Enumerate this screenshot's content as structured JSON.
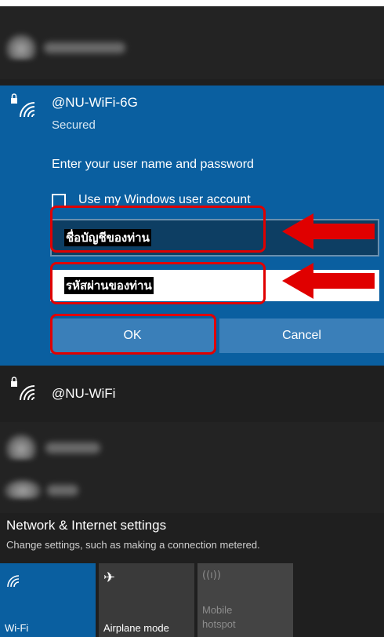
{
  "networks": {
    "selected": {
      "ssid": "@NU-WiFi-6G",
      "status": "Secured",
      "prompt": "Enter your user name and password",
      "checkbox_label": "Use my Windows user account",
      "username_value": "ชื่อบัญชีของท่าน",
      "password_value": "รหัสผ่านของท่าน",
      "ok_label": "OK",
      "cancel_label": "Cancel"
    },
    "other": {
      "ssid": "@NU-WiFi"
    }
  },
  "settings": {
    "title": "Network & Internet settings",
    "description": "Change settings, such as making a connection metered."
  },
  "quick_actions": [
    {
      "label": "Wi-Fi",
      "icon": "wifi-icon"
    },
    {
      "label": "Airplane mode",
      "icon": "airplane-icon"
    },
    {
      "label_line1": "Mobile",
      "label_line2": "hotspot",
      "icon": "hotspot-icon"
    }
  ],
  "colors": {
    "accent": "#0a5fa0",
    "panel": "#1f1f1f",
    "annotation": "#e00000"
  }
}
